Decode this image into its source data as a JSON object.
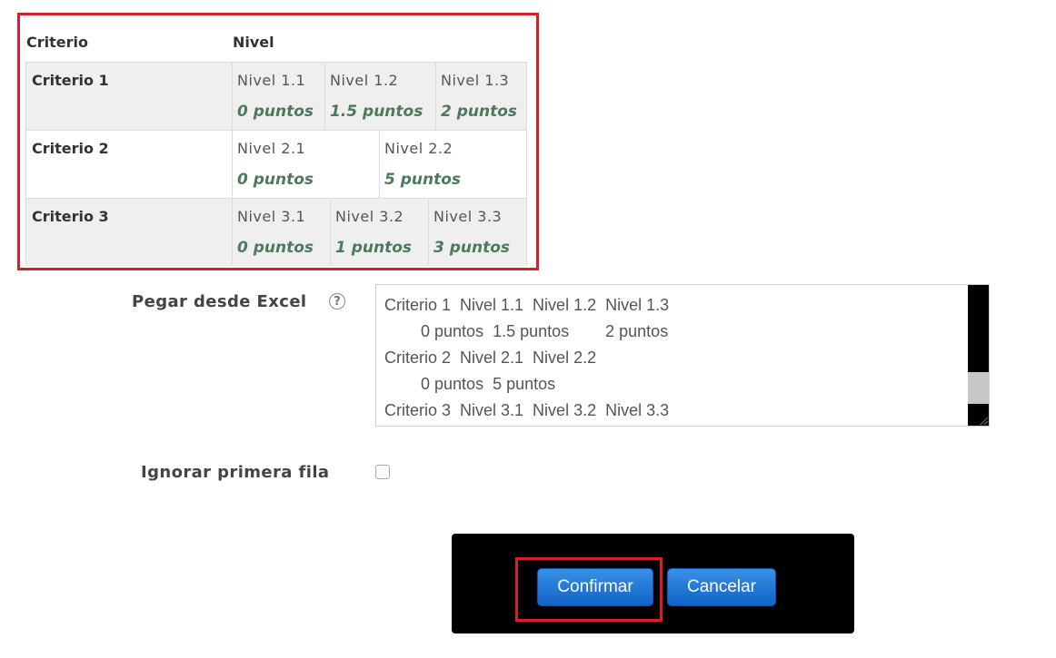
{
  "rubric": {
    "header": {
      "criterion": "Criterio",
      "level": "Nivel"
    },
    "rows": [
      {
        "name": "Criterio 1",
        "levels": [
          {
            "name": "Nivel 1.1",
            "points": "0 puntos"
          },
          {
            "name": "Nivel 1.2",
            "points": "1.5 puntos"
          },
          {
            "name": "Nivel 1.3",
            "points": "2 puntos"
          }
        ]
      },
      {
        "name": "Criterio 2",
        "levels": [
          {
            "name": "Nivel 2.1",
            "points": "0 puntos"
          },
          {
            "name": "Nivel 2.2",
            "points": "5 puntos"
          }
        ]
      },
      {
        "name": "Criterio 3",
        "levels": [
          {
            "name": "Nivel 3.1",
            "points": "0 puntos"
          },
          {
            "name": "Nivel 3.2",
            "points": "1 puntos"
          },
          {
            "name": "Nivel 3.3",
            "points": "3 puntos"
          }
        ]
      }
    ]
  },
  "paste": {
    "label": "Pegar desde Excel",
    "help_icon": "question-circle-icon",
    "value_lines": [
      "Criterio 1  Nivel 1.1  Nivel 1.2  Nivel 1.3",
      "        0 puntos  1.5 puntos        2 puntos",
      "Criterio 2  Nivel 2.1  Nivel 2.2",
      "        0 puntos  5 puntos",
      "Criterio 3  Nivel 3.1  Nivel 3.2  Nivel 3.3"
    ]
  },
  "ignore_first_row": {
    "label": "Ignorar primera fila",
    "checked": false
  },
  "buttons": {
    "confirm": "Confirmar",
    "cancel": "Cancelar"
  },
  "colors": {
    "highlight": "#d4202b",
    "points_text": "#4d7a5b",
    "button_blue": "#1a6fd4"
  }
}
